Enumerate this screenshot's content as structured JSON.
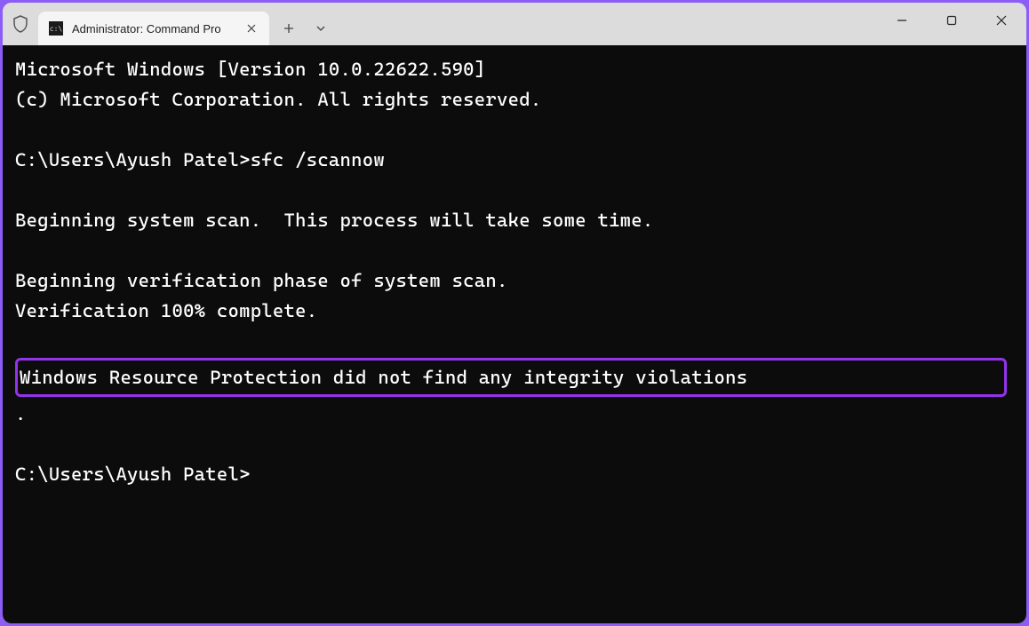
{
  "tab": {
    "title": "Administrator: Command Pro"
  },
  "terminal": {
    "line1": "Microsoft Windows [Version 10.0.22622.590]",
    "line2": "(c) Microsoft Corporation. All rights reserved.",
    "blank1": "",
    "prompt1": "C:\\Users\\Ayush Patel>",
    "command1": "sfc /scannow",
    "blank2": "",
    "line3": "Beginning system scan.  This process will take some time.",
    "blank3": "",
    "line4": "Beginning verification phase of system scan.",
    "line5": "Verification 100% complete.",
    "blank4": "",
    "highlighted": "Windows Resource Protection did not find any integrity violations",
    "period": ".",
    "blank5": "",
    "prompt2": "C:\\Users\\Ayush Patel>"
  }
}
